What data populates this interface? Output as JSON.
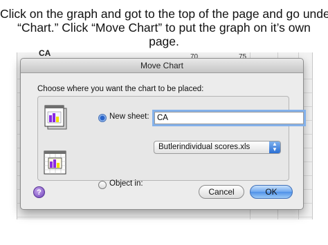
{
  "caption": {
    "line1": "Click on the graph and got to the top of the page and go under",
    "line2": "“Chart.”  Click “Move Chart” to put the graph on it’s own",
    "line3": "page."
  },
  "background_sheet": {
    "title": "CA",
    "col_value_1": "70",
    "col_value_2": "75"
  },
  "dialog": {
    "title": "Move Chart",
    "instruction": "Choose where you want the chart to be placed:",
    "new_sheet": {
      "label": "New sheet:",
      "selected": true,
      "value": "CA"
    },
    "object_in": {
      "label": "Object in:",
      "selected": false,
      "value": "Butlerindividual scores.xls"
    },
    "help_label": "?",
    "cancel_label": "Cancel",
    "ok_label": "OK"
  },
  "colors": {
    "focus_ring": "#84b1ea",
    "default_button": "#6fa8ef",
    "help_button": "#6b3fb8",
    "chart_bar_purple": "#8a2be2",
    "chart_bar_yellow": "#f0e000"
  }
}
